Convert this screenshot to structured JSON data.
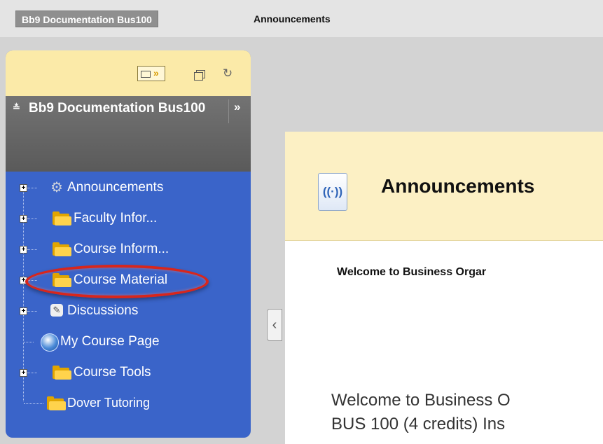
{
  "breadcrumb": {
    "course": "Bb9 Documentation Bus100",
    "page": "Announcements"
  },
  "menu": {
    "toolbar": {
      "folder_icon": "folder-view-icon",
      "window_icon": "new-window-icon",
      "refresh_icon": "refresh-icon"
    },
    "header": {
      "collapse_glyph": "≈",
      "title": "Bb9 Documentation Bus100",
      "expand_glyph": "»"
    },
    "items": [
      {
        "label": "Announcements",
        "icon": "announcements-gear-icon",
        "expandable": true
      },
      {
        "label": "Faculty Infor...",
        "icon": "folder-icon",
        "expandable": true
      },
      {
        "label": "Course Inform...",
        "icon": "folder-icon",
        "expandable": true
      },
      {
        "label": "Course Material",
        "icon": "folder-icon",
        "expandable": true,
        "highlighted": true
      },
      {
        "label": "Discussions",
        "icon": "discussions-icon",
        "expandable": true
      },
      {
        "label": "My Course Page",
        "icon": "globe-icon",
        "expandable": false
      },
      {
        "label": "Course Tools",
        "icon": "folder-icon",
        "expandable": true
      },
      {
        "label": "Dover Tutoring",
        "icon": "folder-icon",
        "expandable": false
      }
    ]
  },
  "content": {
    "title": "Announcements",
    "welcome_heading": "Welcome to Business Orgar",
    "body_line1": "Welcome to Business O",
    "body_line2": "BUS 100 (4 credits)  Ins"
  },
  "colors": {
    "menu_blue": "#3a64c9",
    "toolbar_yellow": "#fbeaa8",
    "header_gray": "#666666",
    "content_header": "#fcf0c4",
    "highlight_red": "#d8261c"
  }
}
